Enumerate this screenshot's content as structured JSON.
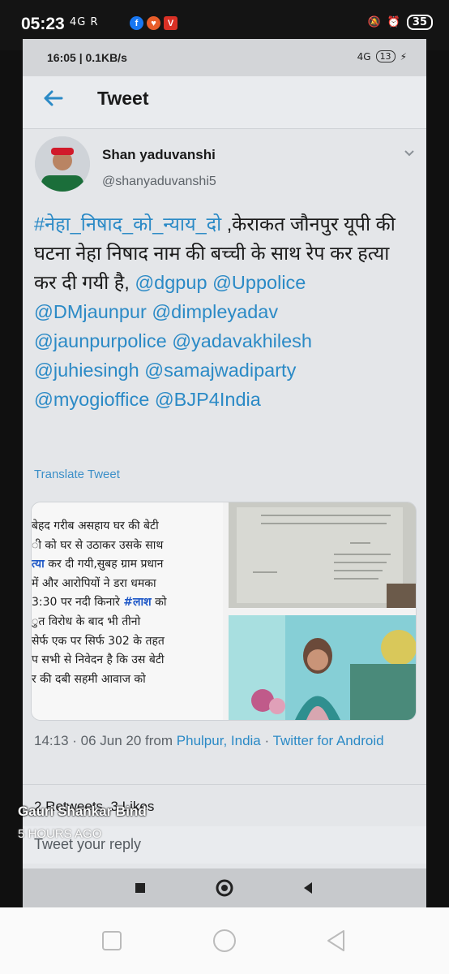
{
  "outer_status": {
    "time": "05:23",
    "signal": "4G R",
    "battery": "35"
  },
  "inner_status": {
    "time_speed": "16:05 | 0.1KB/s",
    "network": "4G",
    "battery": "13"
  },
  "header": {
    "title": "Tweet"
  },
  "author": {
    "name": "Shan yaduvanshi",
    "handle": "@shanyaduvanshi5"
  },
  "tweet": {
    "hashtag": "#नेहा_निषाद_को_न्याय_दो",
    "text": " ,केराकत जौनपुर यूपी की घटना नेहा निषाद नाम की बच्ची के साथ रेप कर हत्या कर दी गयी है,",
    "mentions": [
      "@dgpup",
      "@Uppolice",
      "@DMjaunpur",
      "@dimpleyadav",
      "@jaunpurpolice",
      "@yadavakhilesh",
      "@juhiesingh",
      "@samajwadiparty",
      "@myogioffice",
      "@BJP4India"
    ]
  },
  "translate_label": "Translate Tweet",
  "media_text": {
    "l1": "बेहद गरीब असहाय घर की बेटी",
    "l2": "ी को घर से उठाकर उसके साथ",
    "l3a": "त्या",
    "l3b": " कर दी गयी,सुबह ग्राम प्रधान",
    "l4": "में और आरोपियों ने डरा धमका",
    "l5a": "3:30 पर नदी किनारे ",
    "l5b": "#लाश",
    "l5c": " को",
    "l6": "ुत विरोध के बाद भी तीनो",
    "l7": "सेर्फ एक पर सिर्फ 302 के तहत",
    "l8": "प सभी से निवेदन है कि उस बेटी",
    "l9": "र की दबी सहमी आवाज को"
  },
  "meta": {
    "time_date": "14:13 · 06 Jun 20 from ",
    "location": "Phulpur, India",
    "sep": " · ",
    "source": "Twitter for Android"
  },
  "stats": {
    "retweets": "2 Retweets",
    "likes": "3 Likes"
  },
  "reply_placeholder": "Tweet your reply",
  "story_overlay": {
    "name": "Gauri Shankar Bind",
    "time": "5 HOURS AGO"
  },
  "colors": {
    "link": "#2b8ac6",
    "hashtag_highlight": "#1f58c7"
  }
}
